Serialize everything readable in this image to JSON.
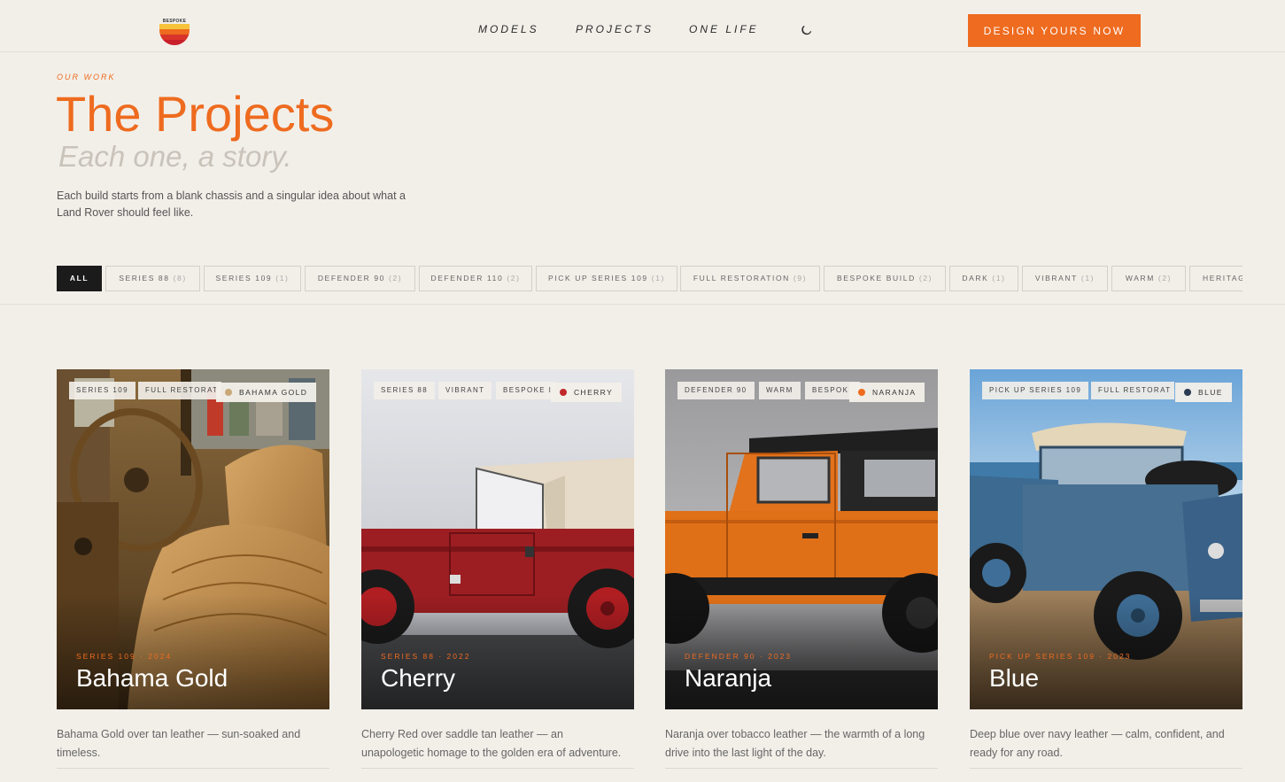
{
  "header": {
    "logo_text": "BESPOKE",
    "logo_colors": [
      "#f6c33a",
      "#ee6b1f",
      "#d8342a"
    ],
    "nav": [
      {
        "label": "MODELS"
      },
      {
        "label": "PROJECTS"
      },
      {
        "label": "ONE LIFE"
      }
    ],
    "theme_icon": "moon-icon",
    "cta_label": "DESIGN YOURS NOW"
  },
  "hero": {
    "eyebrow": "OUR WORK",
    "title": "The Projects",
    "subtitle": "Each one, a story.",
    "description": "Each build starts from a blank chassis and a singular idea about what a Land Rover should feel like."
  },
  "filters": [
    {
      "label": "ALL",
      "count": "",
      "active": true
    },
    {
      "label": "SERIES 88",
      "count": "(8)"
    },
    {
      "label": "SERIES 109",
      "count": "(1)"
    },
    {
      "label": "DEFENDER 90",
      "count": "(2)"
    },
    {
      "label": "DEFENDER 110",
      "count": "(2)"
    },
    {
      "label": "PICK UP SERIES 109",
      "count": "(1)"
    },
    {
      "label": "FULL RESTORATION",
      "count": "(9)"
    },
    {
      "label": "BESPOKE BUILD",
      "count": "(2)"
    },
    {
      "label": "DARK",
      "count": "(1)"
    },
    {
      "label": "VIBRANT",
      "count": "(1)"
    },
    {
      "label": "WARM",
      "count": "(2)"
    },
    {
      "label": "HERITAG",
      "count": ""
    }
  ],
  "accent_color": "#ee6b1f",
  "projects": [
    {
      "tags": [
        "SERIES 109",
        "FULL RESTORAT"
      ],
      "color_label": "BAHAMA GOLD",
      "color_hex": "#c9a877",
      "meta": "SERIES 109 · 2024",
      "name": "Bahama Gold",
      "description": "Bahama Gold over tan leather — sun-soaked and timeless."
    },
    {
      "tags": [
        "SERIES 88",
        "VIBRANT",
        "BESPOKE I"
      ],
      "color_label": "CHERRY",
      "color_hex": "#c0282a",
      "meta": "SERIES 88 · 2022",
      "name": "Cherry",
      "description": "Cherry Red over saddle tan leather — an unapologetic homage to the golden era of adventure."
    },
    {
      "tags": [
        "DEFENDER 90",
        "WARM",
        "BESPOK"
      ],
      "color_label": "NARANJA",
      "color_hex": "#ee6b1f",
      "meta": "DEFENDER 90 · 2023",
      "name": "Naranja",
      "description": "Naranja over tobacco leather — the warmth of a long drive into the last light of the day."
    },
    {
      "tags": [
        "PICK UP SERIES 109",
        "FULL RESTORAT"
      ],
      "color_label": "BLUE",
      "color_hex": "#2a3b52",
      "meta": "PICK UP SERIES 109 · 2023",
      "name": "Blue",
      "description": "Deep blue over navy leather — calm, confident, and ready for any road."
    }
  ]
}
